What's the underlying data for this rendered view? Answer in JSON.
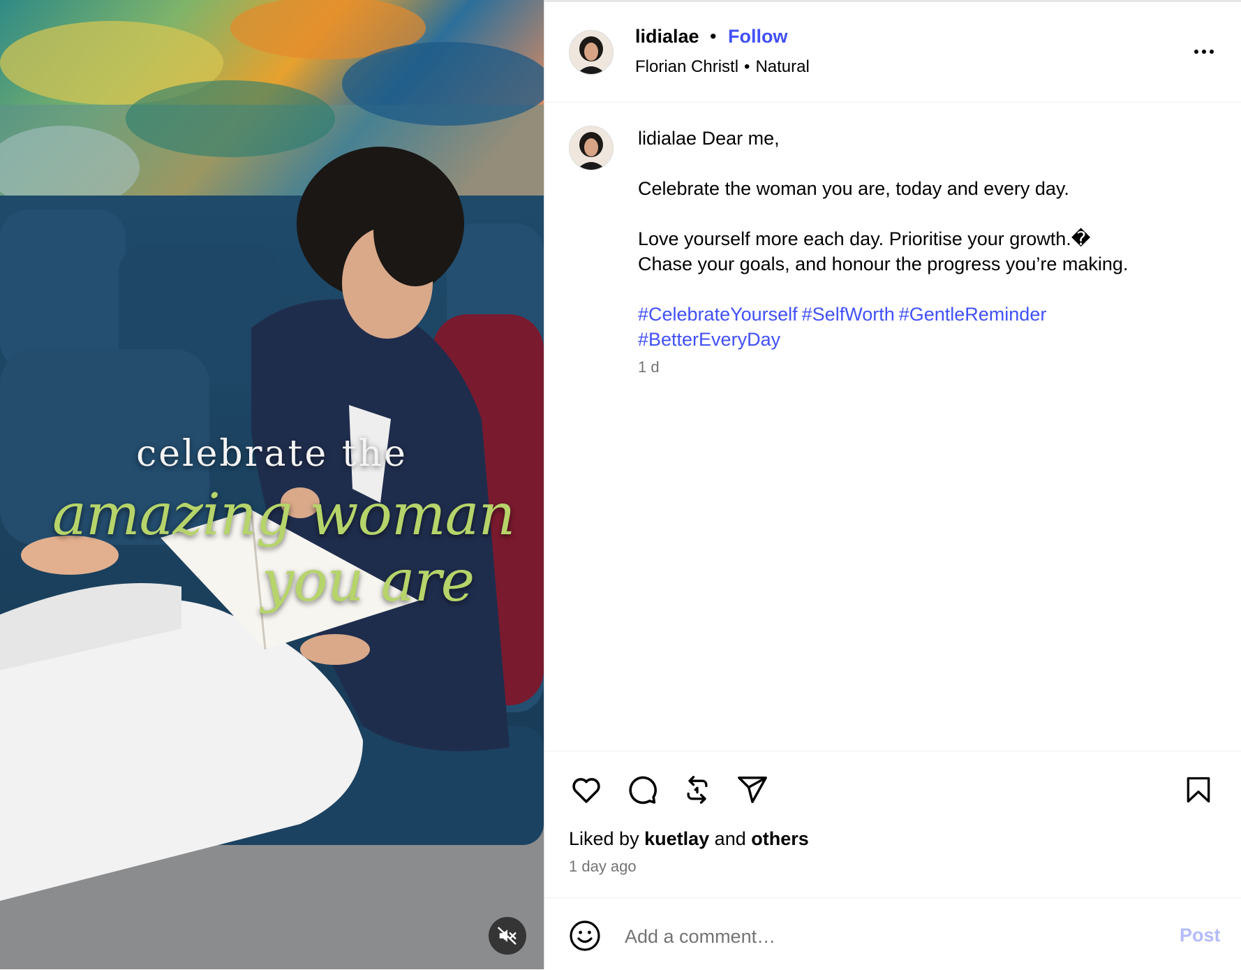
{
  "media": {
    "overlay_line1": "celebrate the",
    "overlay_line2": "amazing woman",
    "overlay_line3": "you are",
    "mute_icon": "speaker-muted-icon",
    "overlay_accent_color": "#b6d46a"
  },
  "header": {
    "username": "lidialae",
    "separator": "•",
    "follow_label": "Follow",
    "audio_artist": "Florian Christl",
    "audio_track": "Natural",
    "more_icon": "more-options-icon"
  },
  "caption": {
    "username": "lidialae",
    "greeting": "Dear me,",
    "line1": "Celebrate the woman you are, today and every day.",
    "line2": "Love yourself more each day. Prioritise your growth.�",
    "line3": "Chase your goals, and honour the progress you’re making.",
    "hashtags": [
      "#CelebrateYourself",
      "#SelfWorth",
      "#GentleReminder",
      "#BetterEveryDay"
    ],
    "time": "1 d"
  },
  "actions": {
    "icons": [
      "heart-icon",
      "comment-icon",
      "repost-icon",
      "share-icon",
      "bookmark-icon"
    ],
    "liked_prefix": "Liked by",
    "liked_user": "kuetlay",
    "liked_and": "and",
    "liked_others": "others",
    "post_age": "1 day ago"
  },
  "comment": {
    "placeholder": "Add a comment…",
    "value": "",
    "post_label": "Post",
    "emoji_icon": "emoji-icon"
  },
  "colors": {
    "link_blue": "#4150f7",
    "post_disabled": "#b3bbfb",
    "secondary_text": "#737373"
  }
}
